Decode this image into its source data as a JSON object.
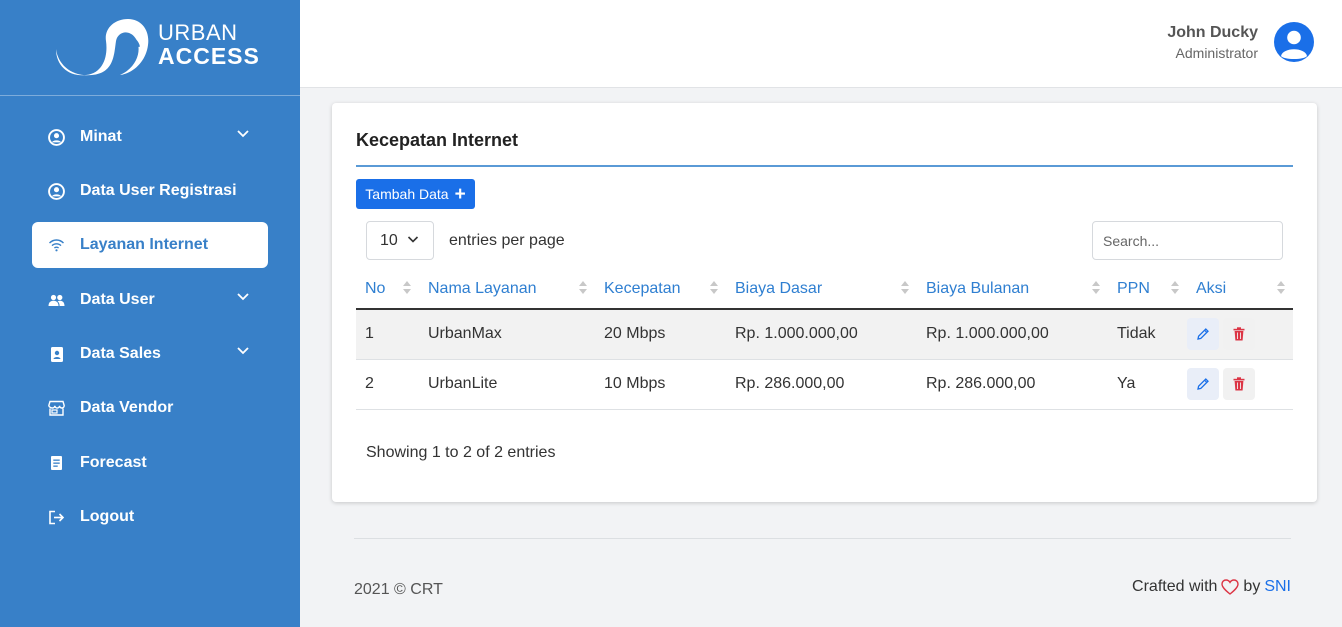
{
  "brand": {
    "line1": "URBAN",
    "line2": "ACCESS"
  },
  "sidebar": {
    "items": [
      {
        "label": "Minat",
        "icon": "user-circle-icon",
        "has_chevron": true,
        "active": false
      },
      {
        "label": "Data User Registrasi",
        "icon": "user-circle-icon",
        "has_chevron": false,
        "active": false
      },
      {
        "label": "Layanan Internet",
        "icon": "wifi-icon",
        "has_chevron": false,
        "active": true
      },
      {
        "label": "Data User",
        "icon": "users-icon",
        "has_chevron": true,
        "active": false
      },
      {
        "label": "Data Sales",
        "icon": "id-badge-icon",
        "has_chevron": true,
        "active": false
      },
      {
        "label": "Data Vendor",
        "icon": "store-icon",
        "has_chevron": false,
        "active": false
      },
      {
        "label": "Forecast",
        "icon": "document-icon",
        "has_chevron": false,
        "active": false
      },
      {
        "label": "Logout",
        "icon": "logout-icon",
        "has_chevron": false,
        "active": false
      }
    ]
  },
  "header": {
    "user_name": "John Ducky",
    "user_role": "Administrator"
  },
  "card": {
    "title": "Kecepatan Internet",
    "add_button": "Tambah Data",
    "per_page_value": "10",
    "per_page_label": "entries per page",
    "search_placeholder": "Search...",
    "columns": [
      "No",
      "Nama Layanan",
      "Kecepatan",
      "Biaya Dasar",
      "Biaya Bulanan",
      "PPN",
      "Aksi"
    ],
    "rows": [
      {
        "no": "1",
        "nama": "UrbanMax",
        "kecepatan": "20 Mbps",
        "biaya_dasar": "Rp. 1.000.000,00",
        "biaya_bulanan": "Rp. 1.000.000,00",
        "ppn": "Tidak"
      },
      {
        "no": "2",
        "nama": "UrbanLite",
        "kecepatan": "10 Mbps",
        "biaya_dasar": "Rp. 286.000,00",
        "biaya_bulanan": "Rp. 286.000,00",
        "ppn": "Ya"
      }
    ],
    "showing": "Showing 1 to 2 of 2 entries"
  },
  "footer": {
    "left": "2021 © CRT",
    "crafted": "Crafted with",
    "by": "by",
    "link": "SNI"
  },
  "colors": {
    "sidebar": "#3880c8",
    "primary": "#1a6fe8",
    "danger": "#dc3545"
  }
}
